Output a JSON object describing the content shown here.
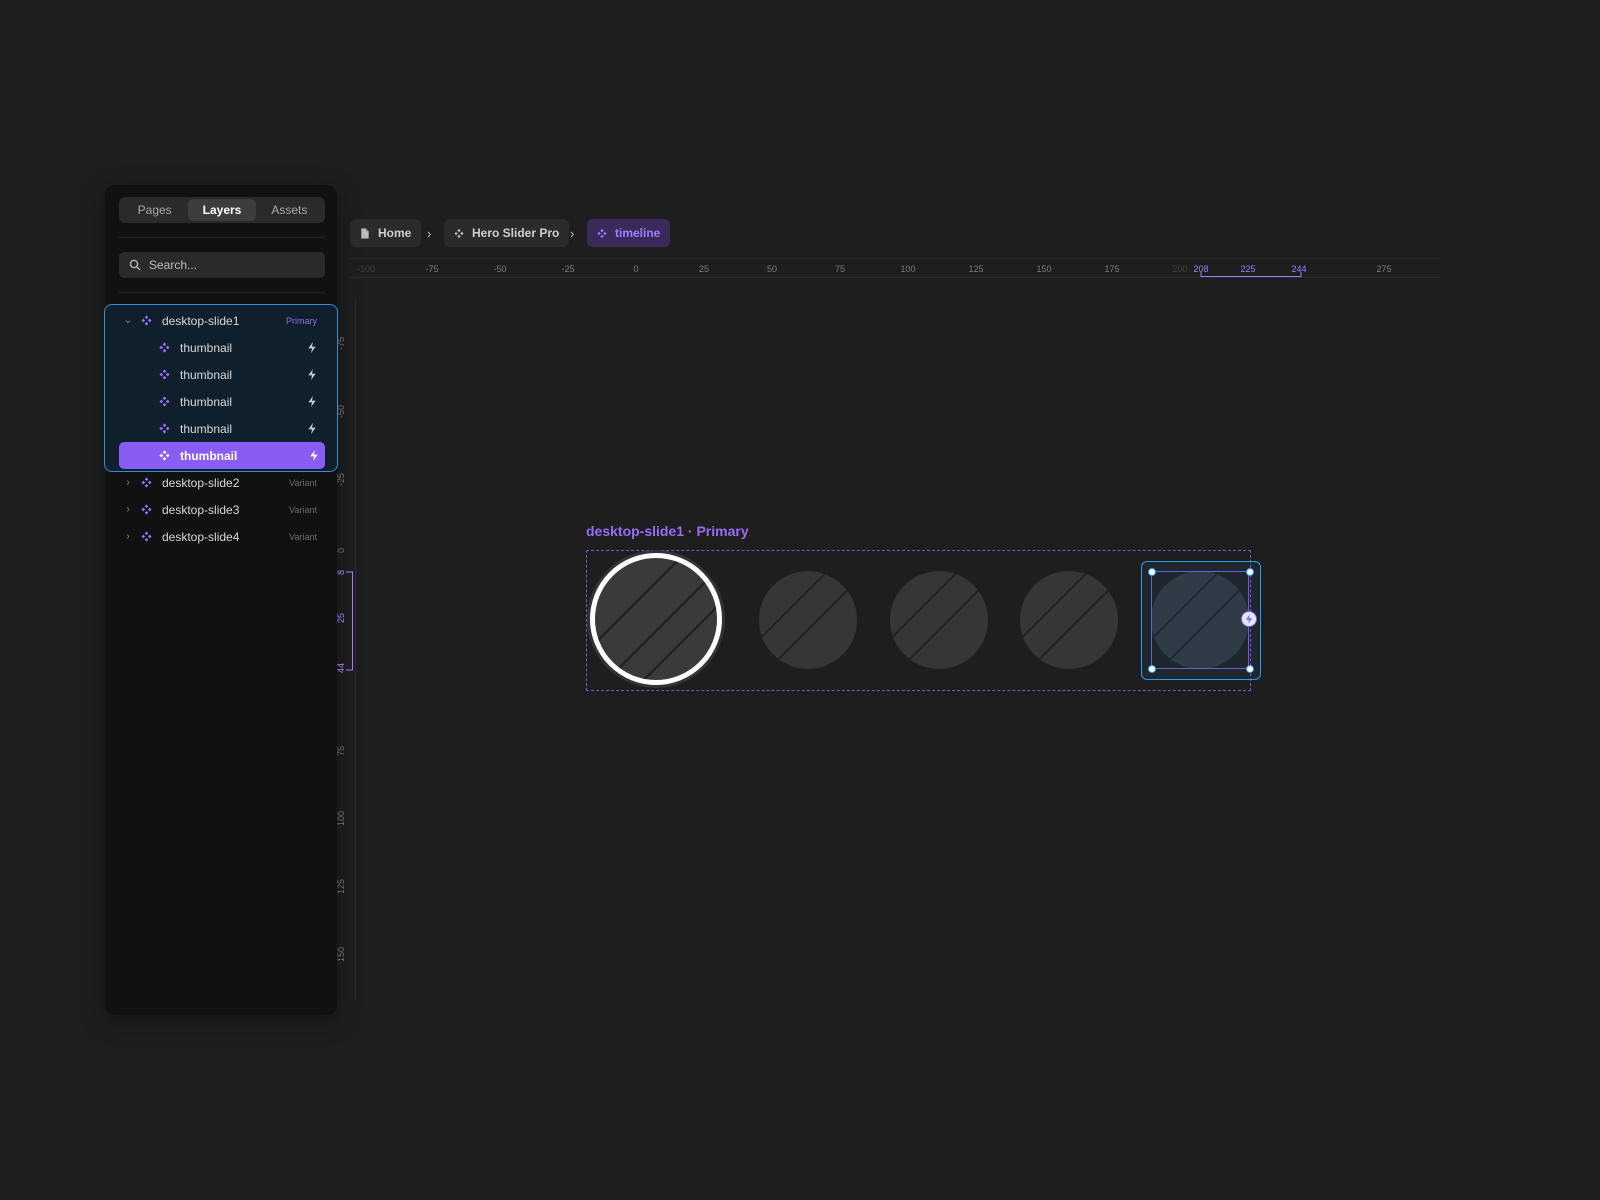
{
  "panel": {
    "tabs": [
      {
        "label": "Pages",
        "active": false
      },
      {
        "label": "Layers",
        "active": true
      },
      {
        "label": "Assets",
        "active": false
      }
    ],
    "search": {
      "placeholder": "Search..."
    },
    "layers": [
      {
        "label": "desktop-slide1",
        "tag": "Primary",
        "expanded": true
      },
      {
        "label": "thumbnail",
        "interaction": "bolt-icon"
      },
      {
        "label": "thumbnail",
        "interaction": "bolt-icon"
      },
      {
        "label": "thumbnail",
        "interaction": "bolt-icon"
      },
      {
        "label": "thumbnail",
        "interaction": "bolt-icon"
      },
      {
        "label": "thumbnail",
        "interaction": "bolt-icon",
        "selected": true
      },
      {
        "label": "desktop-slide2",
        "tag": "Variant",
        "expanded": false
      },
      {
        "label": "desktop-slide3",
        "tag": "Variant",
        "expanded": false
      },
      {
        "label": "desktop-slide4",
        "tag": "Variant",
        "expanded": false
      }
    ]
  },
  "breadcrumb": [
    {
      "label": "Home",
      "icon": "page-icon"
    },
    {
      "label": "Hero Slider Pro",
      "icon": "component-icon"
    },
    {
      "label": "timeline",
      "icon": "component-icon",
      "current": true
    }
  ],
  "ruler_h": {
    "ticks": [
      "-100",
      "-75",
      "-50",
      "-25",
      "0",
      "25",
      "50",
      "75",
      "100",
      "125",
      "150",
      "175",
      "200",
      "208",
      "225",
      "244",
      "275"
    ],
    "highlighted": [
      "208",
      "225",
      "244"
    ],
    "dimmed": [
      "200"
    ]
  },
  "ruler_v": {
    "ticks": [
      "-75",
      "-50",
      "-25",
      "0",
      "8",
      "25",
      "44",
      "75",
      "100",
      "125",
      "150"
    ],
    "highlighted": [
      "8",
      "25",
      "44"
    ]
  },
  "canvas": {
    "frame_title": "desktop-slide1 · Primary",
    "thumbnails": 5,
    "active_thumbnail": 1,
    "selected_thumbnail": 5
  },
  "colors": {
    "accent": "#8a5cf6",
    "selection": "#2e9bf0",
    "background": "#1e1e1e",
    "panel": "#111111"
  }
}
